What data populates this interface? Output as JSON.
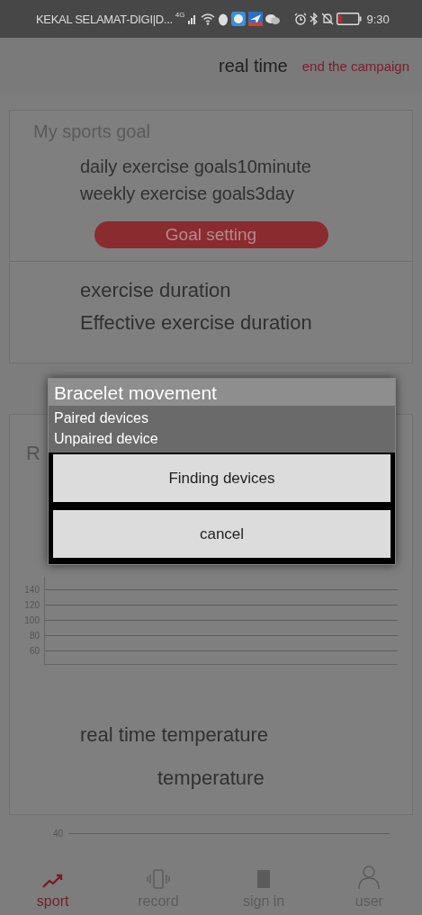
{
  "status_bar": {
    "carrier": "KEKAL SELAMAT-DIGI|D...",
    "network": "4G",
    "time": "9:30"
  },
  "header": {
    "title": "real time",
    "action": "end the campaign"
  },
  "goal_section": {
    "title": "My sports goal",
    "lines": [
      "daily exercise goals10minute",
      "weekly exercise goals3day"
    ],
    "button": "Goal setting"
  },
  "duration_section": {
    "lines": [
      "exercise duration",
      "Effective exercise duration"
    ]
  },
  "heart_section": {
    "title": "R",
    "y_labels": [
      "140",
      "120",
      "100",
      "80",
      "60"
    ]
  },
  "temperature_section": {
    "title": "real time temperature",
    "subtitle": "temperature",
    "y_labels": [
      "40"
    ]
  },
  "tabs": [
    {
      "label": "sport",
      "selected": true
    },
    {
      "label": "record",
      "selected": false
    },
    {
      "label": "sign in",
      "selected": false
    },
    {
      "label": "user",
      "selected": false
    }
  ],
  "dialog": {
    "title": "Bracelet movement",
    "items": [
      "Paired devices",
      "Unpaired device"
    ],
    "buttons": [
      "Finding devices",
      "cancel"
    ]
  }
}
